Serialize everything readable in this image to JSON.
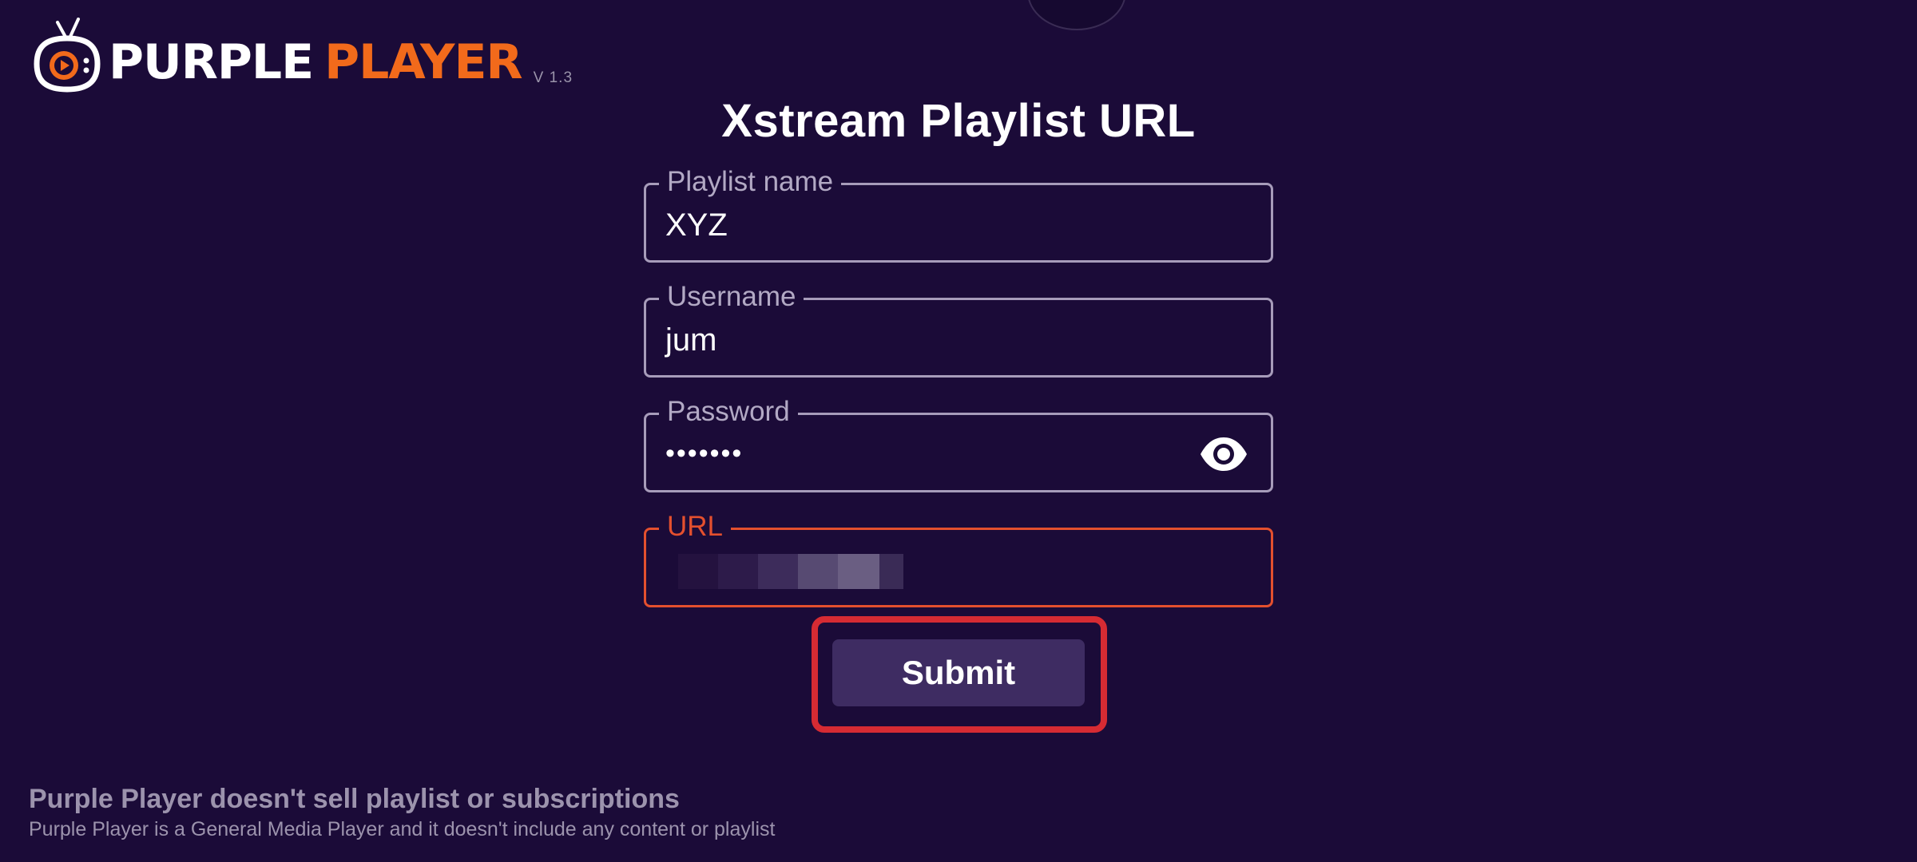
{
  "app": {
    "name_part1": "PURPLE",
    "name_part2": "PLAYER",
    "version": "V 1.3"
  },
  "colors": {
    "background": "#1b0b38",
    "accent_orange": "#f26a1b",
    "field_border": "#a79cba",
    "error": "#e4502e",
    "button_bg": "#3e2c62",
    "highlight_red": "#d62b33"
  },
  "form": {
    "title": "Xstream Playlist URL",
    "fields": [
      {
        "label": "Playlist name",
        "value": "XYZ"
      },
      {
        "label": "Username",
        "value": "jum"
      },
      {
        "label": "Password",
        "value": "•••••••",
        "icon": "eye-icon"
      },
      {
        "label": "URL",
        "value": "",
        "state": "error",
        "note_value_obscured": true
      }
    ],
    "submit_label": "Submit"
  },
  "footer": {
    "title": "Purple Player doesn't sell playlist or subscriptions",
    "subtitle": "Purple Player is a General Media Player and it doesn't include any content or playlist"
  }
}
